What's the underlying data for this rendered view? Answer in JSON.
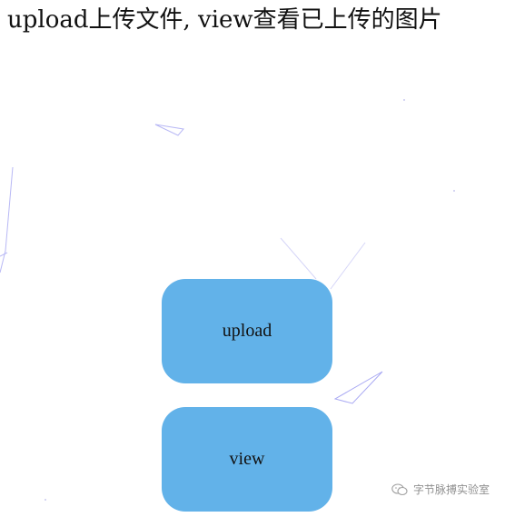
{
  "page": {
    "title": "upload上传文件, view查看已上传的图片"
  },
  "buttons": {
    "upload_label": "upload",
    "view_label": "view"
  },
  "watermark": {
    "text": "字节脉搏实验室",
    "icon": "wechat-icon"
  },
  "colors": {
    "button_bg": "#62b2e9",
    "particle_line": "#b8b8f5"
  }
}
